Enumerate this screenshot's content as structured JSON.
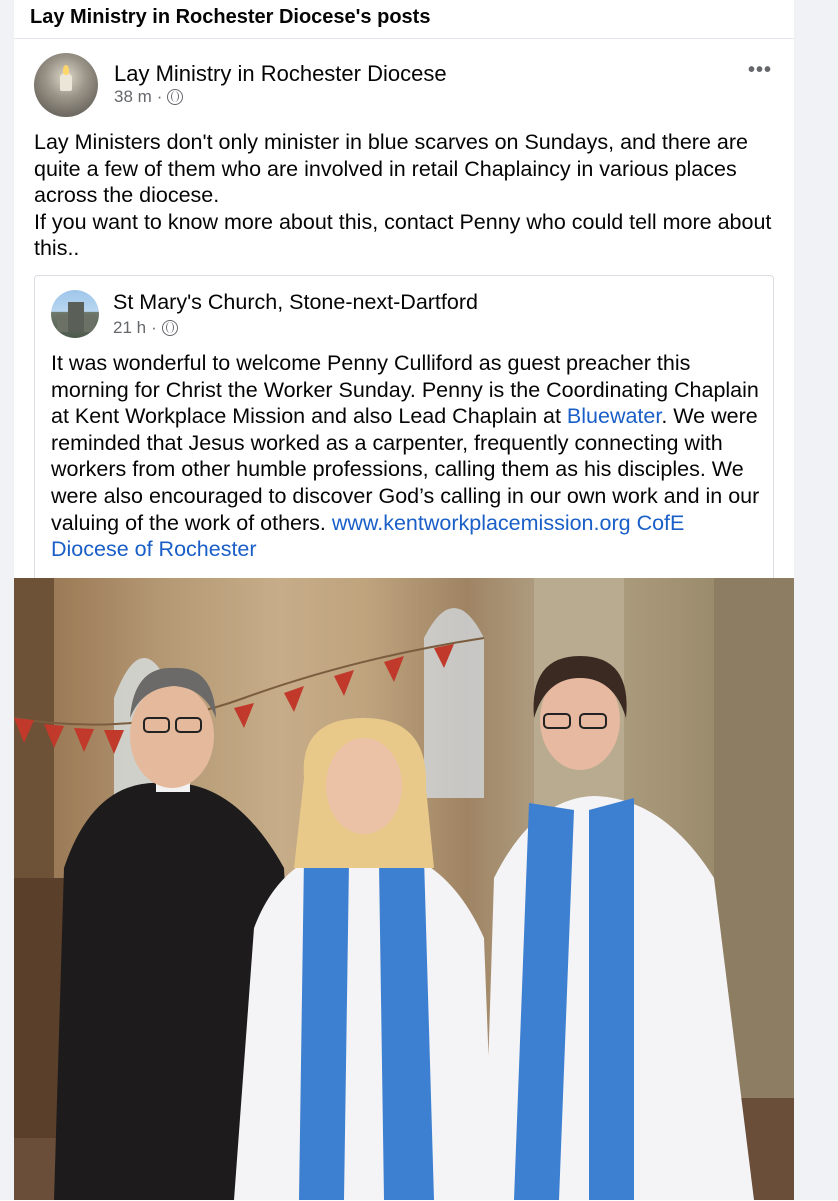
{
  "header": {
    "title": "Lay Ministry in Rochester Diocese's posts"
  },
  "post": {
    "author": "Lay Ministry in Rochester Diocese",
    "time": "38 m",
    "more_label": "•••",
    "text_line1": "Lay Ministers don't only minister in blue scarves on Sundays, and there are quite a few of them who are involved in retail Chaplaincy in various places across the diocese.",
    "text_line2": "If you want to know more about this, contact Penny who could tell more about this.."
  },
  "shared_post": {
    "author": "St Mary's Church, Stone-next-Dartford",
    "time": "21 h",
    "text_part1": "It was wonderful to welcome Penny Culliford as guest preacher this morning for Christ the Worker Sunday. Penny is the Coordinating Chaplain at Kent Workplace Mission and also Lead Chaplain at ",
    "link_bluewater": "Bluewater",
    "text_part2": ". We were reminded that Jesus worked as a carpenter, frequently connecting with workers from other humble professions, calling them as his disciples. We were also encouraged to discover God’s calling in our own work and in our valuing of the work of others. ",
    "link_website": "www.kentworkplacemission.org",
    "link_diocese": "CofE Diocese of Rochester"
  },
  "colors": {
    "link": "#1a5fc7",
    "meta": "#65676b",
    "stole_blue": "#3d7fd0"
  }
}
